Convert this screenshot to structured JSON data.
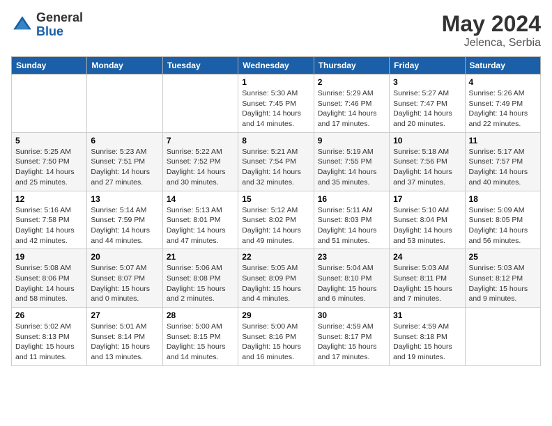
{
  "header": {
    "logo_general": "General",
    "logo_blue": "Blue",
    "month_title": "May 2024",
    "subtitle": "Jelenca, Serbia"
  },
  "days_of_week": [
    "Sunday",
    "Monday",
    "Tuesday",
    "Wednesday",
    "Thursday",
    "Friday",
    "Saturday"
  ],
  "weeks": [
    [
      {
        "day": "",
        "info": ""
      },
      {
        "day": "",
        "info": ""
      },
      {
        "day": "",
        "info": ""
      },
      {
        "day": "1",
        "info": "Sunrise: 5:30 AM\nSunset: 7:45 PM\nDaylight: 14 hours\nand 14 minutes."
      },
      {
        "day": "2",
        "info": "Sunrise: 5:29 AM\nSunset: 7:46 PM\nDaylight: 14 hours\nand 17 minutes."
      },
      {
        "day": "3",
        "info": "Sunrise: 5:27 AM\nSunset: 7:47 PM\nDaylight: 14 hours\nand 20 minutes."
      },
      {
        "day": "4",
        "info": "Sunrise: 5:26 AM\nSunset: 7:49 PM\nDaylight: 14 hours\nand 22 minutes."
      }
    ],
    [
      {
        "day": "5",
        "info": "Sunrise: 5:25 AM\nSunset: 7:50 PM\nDaylight: 14 hours\nand 25 minutes."
      },
      {
        "day": "6",
        "info": "Sunrise: 5:23 AM\nSunset: 7:51 PM\nDaylight: 14 hours\nand 27 minutes."
      },
      {
        "day": "7",
        "info": "Sunrise: 5:22 AM\nSunset: 7:52 PM\nDaylight: 14 hours\nand 30 minutes."
      },
      {
        "day": "8",
        "info": "Sunrise: 5:21 AM\nSunset: 7:54 PM\nDaylight: 14 hours\nand 32 minutes."
      },
      {
        "day": "9",
        "info": "Sunrise: 5:19 AM\nSunset: 7:55 PM\nDaylight: 14 hours\nand 35 minutes."
      },
      {
        "day": "10",
        "info": "Sunrise: 5:18 AM\nSunset: 7:56 PM\nDaylight: 14 hours\nand 37 minutes."
      },
      {
        "day": "11",
        "info": "Sunrise: 5:17 AM\nSunset: 7:57 PM\nDaylight: 14 hours\nand 40 minutes."
      }
    ],
    [
      {
        "day": "12",
        "info": "Sunrise: 5:16 AM\nSunset: 7:58 PM\nDaylight: 14 hours\nand 42 minutes."
      },
      {
        "day": "13",
        "info": "Sunrise: 5:14 AM\nSunset: 7:59 PM\nDaylight: 14 hours\nand 44 minutes."
      },
      {
        "day": "14",
        "info": "Sunrise: 5:13 AM\nSunset: 8:01 PM\nDaylight: 14 hours\nand 47 minutes."
      },
      {
        "day": "15",
        "info": "Sunrise: 5:12 AM\nSunset: 8:02 PM\nDaylight: 14 hours\nand 49 minutes."
      },
      {
        "day": "16",
        "info": "Sunrise: 5:11 AM\nSunset: 8:03 PM\nDaylight: 14 hours\nand 51 minutes."
      },
      {
        "day": "17",
        "info": "Sunrise: 5:10 AM\nSunset: 8:04 PM\nDaylight: 14 hours\nand 53 minutes."
      },
      {
        "day": "18",
        "info": "Sunrise: 5:09 AM\nSunset: 8:05 PM\nDaylight: 14 hours\nand 56 minutes."
      }
    ],
    [
      {
        "day": "19",
        "info": "Sunrise: 5:08 AM\nSunset: 8:06 PM\nDaylight: 14 hours\nand 58 minutes."
      },
      {
        "day": "20",
        "info": "Sunrise: 5:07 AM\nSunset: 8:07 PM\nDaylight: 15 hours\nand 0 minutes."
      },
      {
        "day": "21",
        "info": "Sunrise: 5:06 AM\nSunset: 8:08 PM\nDaylight: 15 hours\nand 2 minutes."
      },
      {
        "day": "22",
        "info": "Sunrise: 5:05 AM\nSunset: 8:09 PM\nDaylight: 15 hours\nand 4 minutes."
      },
      {
        "day": "23",
        "info": "Sunrise: 5:04 AM\nSunset: 8:10 PM\nDaylight: 15 hours\nand 6 minutes."
      },
      {
        "day": "24",
        "info": "Sunrise: 5:03 AM\nSunset: 8:11 PM\nDaylight: 15 hours\nand 7 minutes."
      },
      {
        "day": "25",
        "info": "Sunrise: 5:03 AM\nSunset: 8:12 PM\nDaylight: 15 hours\nand 9 minutes."
      }
    ],
    [
      {
        "day": "26",
        "info": "Sunrise: 5:02 AM\nSunset: 8:13 PM\nDaylight: 15 hours\nand 11 minutes."
      },
      {
        "day": "27",
        "info": "Sunrise: 5:01 AM\nSunset: 8:14 PM\nDaylight: 15 hours\nand 13 minutes."
      },
      {
        "day": "28",
        "info": "Sunrise: 5:00 AM\nSunset: 8:15 PM\nDaylight: 15 hours\nand 14 minutes."
      },
      {
        "day": "29",
        "info": "Sunrise: 5:00 AM\nSunset: 8:16 PM\nDaylight: 15 hours\nand 16 minutes."
      },
      {
        "day": "30",
        "info": "Sunrise: 4:59 AM\nSunset: 8:17 PM\nDaylight: 15 hours\nand 17 minutes."
      },
      {
        "day": "31",
        "info": "Sunrise: 4:59 AM\nSunset: 8:18 PM\nDaylight: 15 hours\nand 19 minutes."
      },
      {
        "day": "",
        "info": ""
      }
    ]
  ]
}
